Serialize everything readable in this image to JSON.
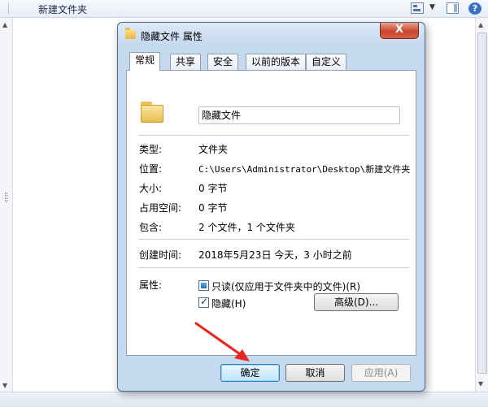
{
  "explorer": {
    "folder_title": "新建文件夹"
  },
  "dialog": {
    "title": "隐藏文件 属性",
    "close_symbol": "X",
    "tabs": [
      "常规",
      "共享",
      "安全",
      "以前的版本",
      "自定义"
    ],
    "active_tab": "常规",
    "name_value": "隐藏文件",
    "rows": [
      {
        "label": "类型:",
        "value": "文件夹"
      },
      {
        "label": "位置:",
        "value": "C:\\Users\\Administrator\\Desktop\\新建文件夹"
      },
      {
        "label": "大小:",
        "value": "0 字节"
      },
      {
        "label": "占用空间:",
        "value": "0 字节"
      },
      {
        "label": "包含:",
        "value": "2 个文件，1 个文件夹"
      }
    ],
    "created": {
      "label": "创建时间:",
      "value": "2018年5月23日 今天，3 小时之前"
    },
    "attributes": {
      "label": "属性:",
      "readonly": {
        "label": "只读(仅应用于文件夹中的文件)(R)",
        "state": "indeterminate"
      },
      "hidden": {
        "label": "隐藏(H)",
        "state": "checked"
      },
      "advanced_button": "高级(D)..."
    },
    "buttons": {
      "ok": "确定",
      "cancel": "取消",
      "apply": "应用(A)"
    }
  },
  "overlay": {
    "arrow_color": "#e8261c"
  }
}
